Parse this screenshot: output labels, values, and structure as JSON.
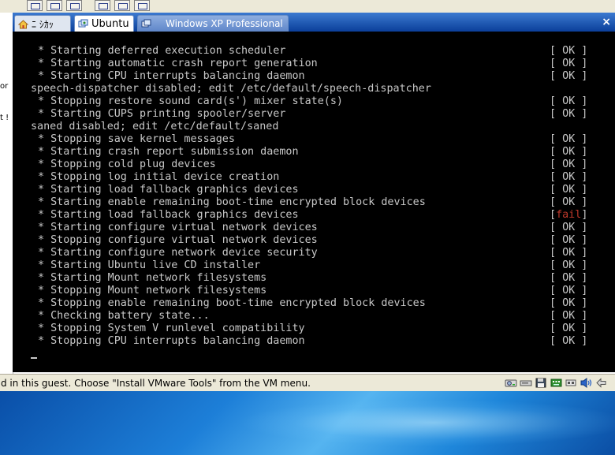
{
  "left_strip": {
    "fragment_1": "or",
    "fragment_2": "t !"
  },
  "tabs": [
    {
      "label": "ﾆ ｼｶｯ",
      "icon": "home-icon"
    },
    {
      "label": "Ubuntu",
      "icon": "vm-icon"
    },
    {
      "label": "Windows XP Professional",
      "icon": "vm-icon"
    }
  ],
  "close_label": "×",
  "console": {
    "lines": [
      {
        "msg": "* Starting deferred execution scheduler",
        "status": "[ OK ]",
        "indent": true
      },
      {
        "msg": "* Starting automatic crash report generation",
        "status": "[ OK ]",
        "indent": true
      },
      {
        "msg": "* Starting CPU interrupts balancing daemon",
        "status": "[ OK ]",
        "indent": true
      },
      {
        "msg": "speech-dispatcher disabled; edit /etc/default/speech-dispatcher",
        "status": "",
        "indent": false
      },
      {
        "msg": "* Stopping restore sound card(s') mixer state(s)",
        "status": "[ OK ]",
        "indent": true
      },
      {
        "msg": "* Starting CUPS printing spooler/server",
        "status": "[ OK ]",
        "indent": true
      },
      {
        "msg": "saned disabled; edit /etc/default/saned",
        "status": "",
        "indent": false
      },
      {
        "msg": "* Stopping save kernel messages",
        "status": "[ OK ]",
        "indent": true
      },
      {
        "msg": "* Starting crash report submission daemon",
        "status": "[ OK ]",
        "indent": true
      },
      {
        "msg": "* Stopping cold plug devices",
        "status": "[ OK ]",
        "indent": true
      },
      {
        "msg": "* Stopping log initial device creation",
        "status": "[ OK ]",
        "indent": true
      },
      {
        "msg": "* Starting load fallback graphics devices",
        "status": "[ OK ]",
        "indent": true
      },
      {
        "msg": "* Starting enable remaining boot-time encrypted block devices",
        "status": "[ OK ]",
        "indent": true
      },
      {
        "msg": "* Starting load fallback graphics devices",
        "status": "[fail]",
        "indent": true
      },
      {
        "msg": "* Starting configure virtual network devices",
        "status": "[ OK ]",
        "indent": true
      },
      {
        "msg": "* Stopping configure virtual network devices",
        "status": "[ OK ]",
        "indent": true
      },
      {
        "msg": "* Starting configure network device security",
        "status": "[ OK ]",
        "indent": true
      },
      {
        "msg": "* Starting Ubuntu live CD installer",
        "status": "[ OK ]",
        "indent": true
      },
      {
        "msg": "* Starting Mount network filesystems",
        "status": "[ OK ]",
        "indent": true
      },
      {
        "msg": "* Stopping Mount network filesystems",
        "status": "[ OK ]",
        "indent": true
      },
      {
        "msg": "* Stopping enable remaining boot-time encrypted block devices",
        "status": "[ OK ]",
        "indent": true
      },
      {
        "msg": "* Checking battery state...",
        "status": "[ OK ]",
        "indent": true
      },
      {
        "msg": "* Stopping System V runlevel compatibility",
        "status": "[ OK ]",
        "indent": true
      },
      {
        "msg": "* Stopping CPU interrupts balancing daemon",
        "status": "[ OK ]",
        "indent": true
      }
    ]
  },
  "statusbar": {
    "text": "d in this guest. Choose \"Install VMware Tools\" from the VM menu.",
    "tray_icons": [
      "hard-disk-icon",
      "cdrom-icon",
      "floppy-icon",
      "network-icon",
      "usb-icon",
      "sound-icon",
      "arrows-icon"
    ]
  },
  "colors": {
    "fail": "#c0392b",
    "console_text": "#c8c8c8",
    "console_bg": "#000000"
  }
}
